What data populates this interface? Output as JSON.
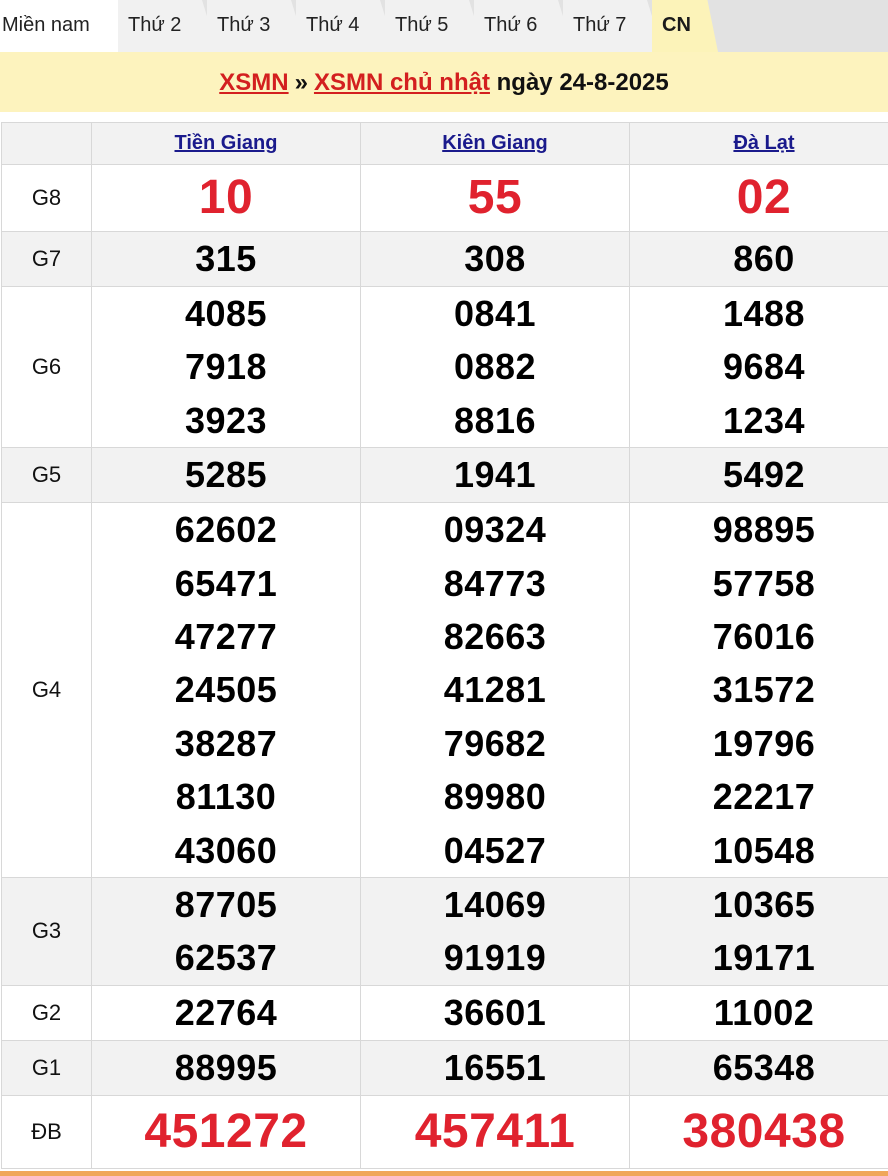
{
  "tabs": {
    "region": "Miền nam",
    "days": [
      "Thứ 2",
      "Thứ 3",
      "Thứ 4",
      "Thứ 5",
      "Thứ 6",
      "Thứ 7"
    ],
    "active": "CN"
  },
  "title": {
    "link1": "XSMN",
    "separator": "»",
    "link2": "XSMN chủ nhật",
    "date_text": "ngày 24-8-2025"
  },
  "provinces": [
    "Tiền Giang",
    "Kiên Giang",
    "Đà Lạt"
  ],
  "rows": {
    "g8": {
      "label": "G8",
      "values": [
        [
          "10"
        ],
        [
          "55"
        ],
        [
          "02"
        ]
      ]
    },
    "g7": {
      "label": "G7",
      "values": [
        [
          "315"
        ],
        [
          "308"
        ],
        [
          "860"
        ]
      ]
    },
    "g6": {
      "label": "G6",
      "values": [
        [
          "4085",
          "7918",
          "3923"
        ],
        [
          "0841",
          "0882",
          "8816"
        ],
        [
          "1488",
          "9684",
          "1234"
        ]
      ]
    },
    "g5": {
      "label": "G5",
      "values": [
        [
          "5285"
        ],
        [
          "1941"
        ],
        [
          "5492"
        ]
      ]
    },
    "g4": {
      "label": "G4",
      "values": [
        [
          "62602",
          "65471",
          "47277",
          "24505",
          "38287",
          "81130",
          "43060"
        ],
        [
          "09324",
          "84773",
          "82663",
          "41281",
          "79682",
          "89980",
          "04527"
        ],
        [
          "98895",
          "57758",
          "76016",
          "31572",
          "19796",
          "22217",
          "10548"
        ]
      ]
    },
    "g3": {
      "label": "G3",
      "values": [
        [
          "87705",
          "62537"
        ],
        [
          "14069",
          "91919"
        ],
        [
          "10365",
          "19171"
        ]
      ]
    },
    "g2": {
      "label": "G2",
      "values": [
        [
          "22764"
        ],
        [
          "36601"
        ],
        [
          "11002"
        ]
      ]
    },
    "g1": {
      "label": "G1",
      "values": [
        [
          "88995"
        ],
        [
          "16551"
        ],
        [
          "65348"
        ]
      ]
    },
    "db": {
      "label": "ĐB",
      "values": [
        [
          "451272"
        ],
        [
          "457411"
        ],
        [
          "380438"
        ]
      ]
    }
  },
  "colors": {
    "accent_red": "#e0222e",
    "title_bg": "#fdf3be",
    "link_blue": "#1a1a8c",
    "bottom_bar": "#f0a75a"
  }
}
